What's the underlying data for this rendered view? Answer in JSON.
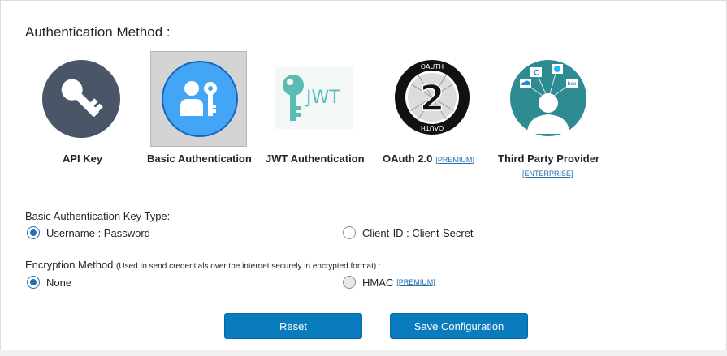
{
  "section": {
    "title": "Authentication Method :"
  },
  "methods": [
    {
      "label": "API Key",
      "icon": "key-icon"
    },
    {
      "label": "Basic Authentication",
      "icon": "user-key-icon",
      "selected": true
    },
    {
      "label": "JWT Authentication",
      "icon": "jwt-key-icon"
    },
    {
      "label": "OAuth 2.0",
      "icon": "oauth2-icon",
      "tag": "[PREMIUM]"
    },
    {
      "label": "Third Party Provider",
      "icon": "third-party-provider-icon",
      "tag": "[ENTERPRISE]"
    }
  ],
  "jwt_logo_text": "JWT",
  "oauth_logo": {
    "ring_top": "OAUTH",
    "ring_bottom": "OAUTH",
    "number": "2"
  },
  "provider_badges": [
    "C",
    "box"
  ],
  "key_type": {
    "label": "Basic Authentication Key Type:",
    "options": [
      {
        "label": "Username : Password",
        "checked": true
      },
      {
        "label": "Client-ID : Client-Secret",
        "checked": false
      }
    ]
  },
  "encryption": {
    "label": "Encryption Method",
    "note": "(Used to send credentials over the internet securely in encrypted format) :",
    "options": [
      {
        "label": "None",
        "checked": true
      },
      {
        "label": "HMAC",
        "checked": false,
        "tag": "[PREMIUM]"
      }
    ]
  },
  "buttons": {
    "reset": "Reset",
    "save": "Save Configuration"
  },
  "colors": {
    "accent": "#0a7bbd",
    "link": "#2271b1",
    "api_key_circle": "#4a5568",
    "basic_circle": "#42a5f5",
    "jwt_teal": "#5bbcb6",
    "provider_teal": "#2e8b92"
  }
}
